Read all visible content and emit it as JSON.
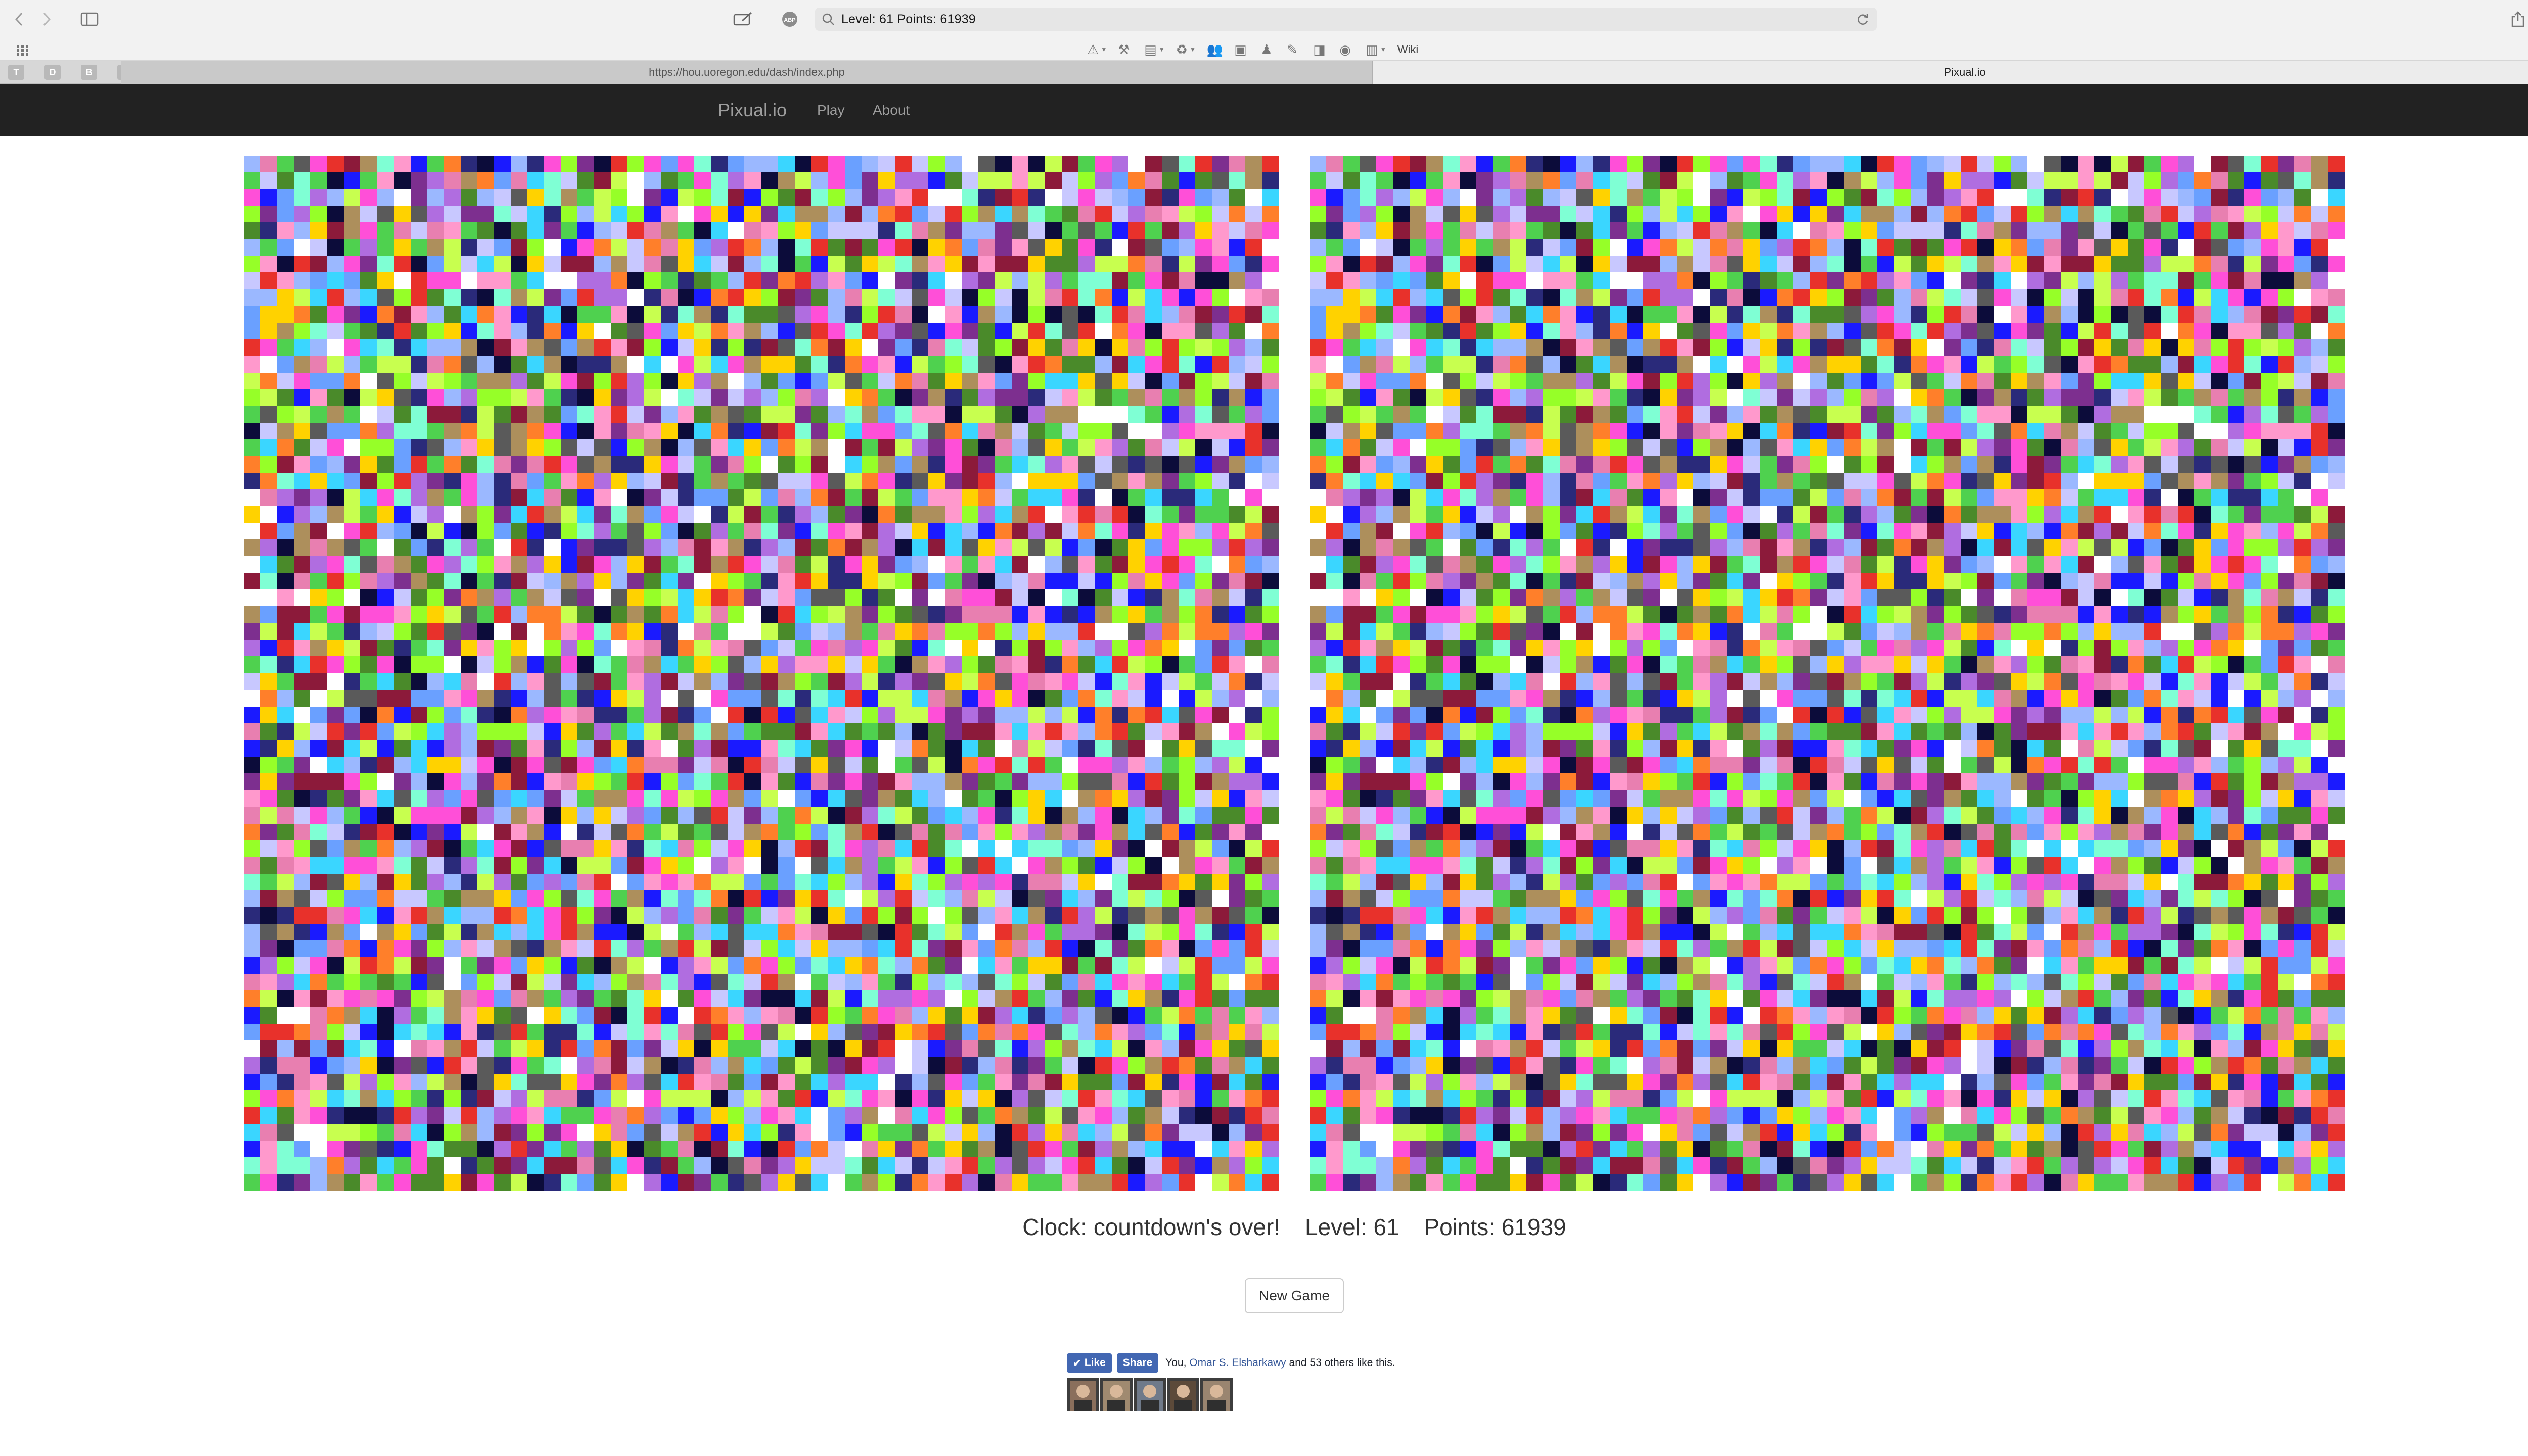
{
  "browser": {
    "address_text": "Level: 61   Points: 61939",
    "favorites": [
      {
        "icon": "warning-icon",
        "glyph": "⚠",
        "dropdown": true
      },
      {
        "icon": "tools-icon",
        "glyph": "⚒",
        "dropdown": false
      },
      {
        "icon": "folder-icon",
        "glyph": "▤",
        "dropdown": true
      },
      {
        "icon": "recycle-icon",
        "glyph": "♻",
        "dropdown": true
      },
      {
        "icon": "people-icon",
        "glyph": "👥",
        "dropdown": false
      },
      {
        "icon": "package-icon",
        "glyph": "▣",
        "dropdown": false
      },
      {
        "icon": "person-icon",
        "glyph": "♟",
        "dropdown": false
      },
      {
        "icon": "notes-icon",
        "glyph": "✎",
        "dropdown": false
      },
      {
        "icon": "bookmark-icon",
        "glyph": "◨",
        "dropdown": false
      },
      {
        "icon": "disk-icon",
        "glyph": "◉",
        "dropdown": false
      },
      {
        "icon": "cabinet-icon",
        "glyph": "▥",
        "dropdown": true
      }
    ],
    "favorites_wiki": "Wiki",
    "pinned_tabs": [
      "T",
      "D",
      "B",
      "R",
      "⟳"
    ],
    "tabs": [
      {
        "title": "https://hou.uoregon.edu/dash/index.php"
      },
      {
        "title": "Pixual.io"
      }
    ]
  },
  "site": {
    "brand": "Pixual.io",
    "nav": [
      "Play",
      "About"
    ]
  },
  "game": {
    "grid_size": 62,
    "palette": [
      "#e8312b",
      "#ff4fd8",
      "#ffd200",
      "#96ff28",
      "#7fffd4",
      "#6aa0ff",
      "#1a1aff",
      "#0c0c3a",
      "#ffffff",
      "#b06de0",
      "#e87fb0",
      "#ff7f2a",
      "#4a8a2a",
      "#8c1a3a",
      "#5a5a5a",
      "#ad8f5c",
      "#c8ff4f",
      "#4fd14f",
      "#2a2a7a",
      "#9bb8ff",
      "#ff99cc",
      "#c8c8ff",
      "#3ad6ff",
      "#7d2f8f"
    ],
    "status": {
      "clock": "Clock: countdown's over!",
      "level": "Level: 61",
      "points": "Points: 61939"
    },
    "new_game_label": "New Game"
  },
  "facebook": {
    "like_label": "Like",
    "share_label": "Share",
    "text_prefix": "You,",
    "friend_name": "Omar S. Elsharkawy",
    "text_suffix": "and 53 others like this.",
    "face_colors": [
      "#8a6f5c",
      "#a08a70",
      "#6f7a8a",
      "#5c4a3a",
      "#9a8570"
    ]
  }
}
